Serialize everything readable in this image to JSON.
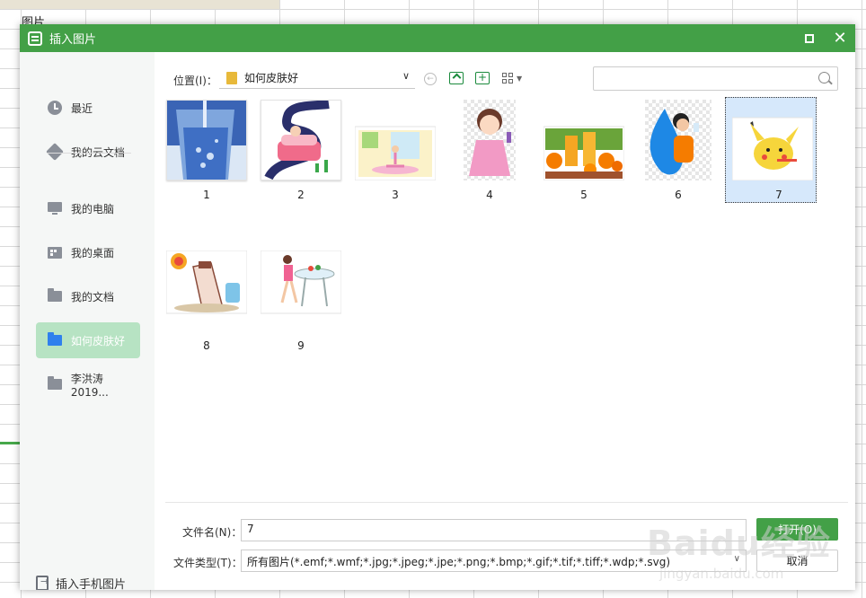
{
  "background": {
    "cell_text": "图片"
  },
  "dialog": {
    "title": "插入图片",
    "accent_color": "#43a047"
  },
  "sidebar": {
    "items": [
      {
        "label": "最近",
        "icon": "clock-icon"
      },
      {
        "label": "我的云文档",
        "icon": "cube-icon"
      },
      {
        "label": "我的电脑",
        "icon": "monitor-icon"
      },
      {
        "label": "我的桌面",
        "icon": "desktop-icon"
      },
      {
        "label": "我的文档",
        "icon": "folder-icon"
      },
      {
        "label": "如何皮肤好",
        "icon": "folder-icon",
        "active": true
      },
      {
        "label": "李洪涛2019...",
        "icon": "folder-icon"
      }
    ],
    "phone_insert_label": "插入手机图片"
  },
  "location": {
    "label": "位置(I)：",
    "current_folder": "如何皮肤好"
  },
  "search": {
    "placeholder": ""
  },
  "thumbnails": [
    {
      "label": "1"
    },
    {
      "label": "2"
    },
    {
      "label": "3"
    },
    {
      "label": "4"
    },
    {
      "label": "5"
    },
    {
      "label": "6"
    },
    {
      "label": "7",
      "selected": true
    },
    {
      "label": "8"
    },
    {
      "label": "9"
    }
  ],
  "footer": {
    "filename_label": "文件名(N)：",
    "filename_value": "7",
    "filetype_label": "文件类型(T)：",
    "filetype_value": "所有图片(*.emf;*.wmf;*.jpg;*.jpeg;*.jpe;*.png;*.bmp;*.gif;*.tif;*.tiff;*.wdp;*.svg)",
    "open_button": "打开(O)",
    "cancel_button": "取消"
  },
  "watermark": {
    "logo_text": "Baidu经验",
    "url_text": "jingyan.baidu.com"
  }
}
